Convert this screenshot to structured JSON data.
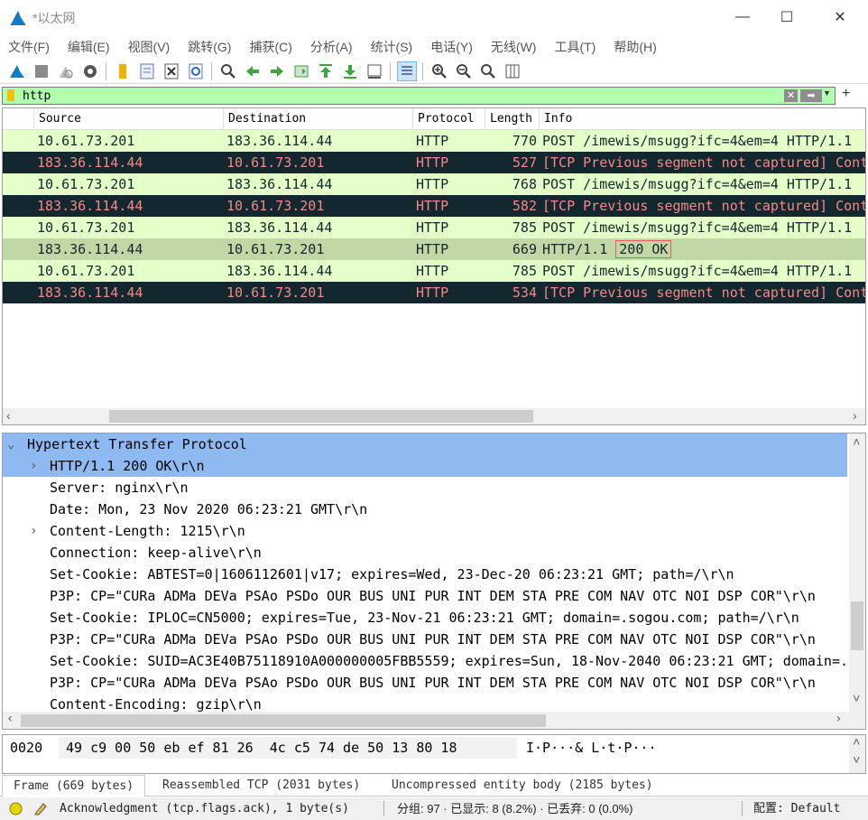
{
  "window": {
    "title": "*以太网",
    "controls": {
      "minimize": "—",
      "maximize": "☐",
      "close": "✕"
    }
  },
  "menu": [
    "文件(F)",
    "编辑(E)",
    "视图(V)",
    "跳转(G)",
    "捕获(C)",
    "分析(A)",
    "统计(S)",
    "电话(Y)",
    "无线(W)",
    "工具(T)",
    "帮助(H)"
  ],
  "toolbar": {
    "icons": [
      "shark-fin-start-icon",
      "stop-icon",
      "restart-icon",
      "options-gear-icon",
      "open-folder-icon",
      "save-file-icon",
      "close-file-icon",
      "reload-icon",
      "find-icon",
      "back-arrow-icon",
      "forward-arrow-icon",
      "go-to-packet-icon",
      "first-packet-icon",
      "last-packet-icon",
      "autoscroll-icon",
      "colorize-icon",
      "zoom-in-icon",
      "zoom-out-icon",
      "zoom-normal-icon",
      "resize-columns-icon"
    ]
  },
  "filter": {
    "value": "http",
    "clear_glyph": "✕",
    "apply_glyph": "➡",
    "dropdown_glyph": "▼",
    "add_glyph": "+"
  },
  "packet_list": {
    "columns": [
      "Source",
      "Destination",
      "Protocol",
      "Length",
      "Info"
    ],
    "rows": [
      {
        "src": "10.61.73.201",
        "dst": "183.36.114.44",
        "proto": "HTTP",
        "len": "770",
        "info": "POST /imewis/msugg?ifc=4&em=4 HTTP/1.1",
        "style": "normal"
      },
      {
        "src": "183.36.114.44",
        "dst": "10.61.73.201",
        "proto": "HTTP",
        "len": "527",
        "info": "[TCP Previous segment not captured] Continuation",
        "style": "error"
      },
      {
        "src": "10.61.73.201",
        "dst": "183.36.114.44",
        "proto": "HTTP",
        "len": "768",
        "info": "POST /imewis/msugg?ifc=4&em=4 HTTP/1.1",
        "style": "normal"
      },
      {
        "src": "183.36.114.44",
        "dst": "10.61.73.201",
        "proto": "HTTP",
        "len": "582",
        "info": "[TCP Previous segment not captured] Continuation",
        "style": "error"
      },
      {
        "src": "10.61.73.201",
        "dst": "183.36.114.44",
        "proto": "HTTP",
        "len": "785",
        "info": "POST /imewis/msugg?ifc=4&em=4 HTTP/1.1",
        "style": "normal"
      },
      {
        "src": "183.36.114.44",
        "dst": "10.61.73.201",
        "proto": "HTTP",
        "len": "669",
        "info_prefix": "HTTP/1.1 ",
        "info_boxed": "200 OK",
        "style": "selected"
      },
      {
        "src": "10.61.73.201",
        "dst": "183.36.114.44",
        "proto": "HTTP",
        "len": "785",
        "info": "POST /imewis/msugg?ifc=4&em=4 HTTP/1.1",
        "style": "normal"
      },
      {
        "src": "183.36.114.44",
        "dst": "10.61.73.201",
        "proto": "HTTP",
        "len": "534",
        "info": "[TCP Previous segment not captured] Continuation",
        "style": "error"
      }
    ]
  },
  "details": [
    {
      "text": "Hypertext Transfer Protocol",
      "indent": 0,
      "toggle": "⌄",
      "highlight": true
    },
    {
      "text": "HTTP/1.1 200 OK\\r\\n",
      "indent": 1,
      "toggle": "›",
      "highlight": true
    },
    {
      "text": "Server: nginx\\r\\n",
      "indent": 1
    },
    {
      "text": "Date: Mon, 23 Nov 2020 06:23:21 GMT\\r\\n",
      "indent": 1
    },
    {
      "text": "Content-Length: 1215\\r\\n",
      "indent": 1,
      "toggle": "›"
    },
    {
      "text": "Connection: keep-alive\\r\\n",
      "indent": 1
    },
    {
      "text": "Set-Cookie: ABTEST=0|1606112601|v17; expires=Wed, 23-Dec-20 06:23:21 GMT; path=/\\r\\n",
      "indent": 1
    },
    {
      "text": "P3P: CP=\"CURa ADMa DEVa PSAo PSDo OUR BUS UNI PUR INT DEM STA PRE COM NAV OTC NOI DSP COR\"\\r\\n",
      "indent": 1
    },
    {
      "text": "Set-Cookie: IPLOC=CN5000; expires=Tue, 23-Nov-21 06:23:21 GMT; domain=.sogou.com; path=/\\r\\n",
      "indent": 1
    },
    {
      "text": "P3P: CP=\"CURa ADMa DEVa PSAo PSDo OUR BUS UNI PUR INT DEM STA PRE COM NAV OTC NOI DSP COR\"\\r\\n",
      "indent": 1
    },
    {
      "text": "Set-Cookie: SUID=AC3E40B75118910A000000005FBB5559; expires=Sun, 18-Nov-2040 06:23:21 GMT; domain=.sogou.com\\r\\n",
      "indent": 1
    },
    {
      "text": "P3P: CP=\"CURa ADMa DEVa PSAo PSDo OUR BUS UNI PUR INT DEM STA PRE COM NAV OTC NOI DSP COR\"\\r\\n",
      "indent": 1
    },
    {
      "text": "Content-Encoding: gzip\\r\\n",
      "indent": 1
    }
  ],
  "bytes": {
    "offset": "0020",
    "hex": "49 c9 00 50 eb ef 81 26  4c c5 74 de 50 13 80 18",
    "ascii": "I·P···& L·t·P···"
  },
  "byte_tabs": [
    "Frame (669 bytes)",
    "Reassembled TCP (2031 bytes)",
    "Uncompressed entity body (2185 bytes)"
  ],
  "status": {
    "expert": "Acknowledgment (tcp.flags.ack), 1 byte(s)",
    "packets": "分组: 97 · 已显示: 8 (8.2%) · 已丢弃: 0 (0.0%)",
    "profile": "配置: Default"
  },
  "colors": {
    "row_normal_bg": "#e4ffc7",
    "row_normal_fg": "#12272e",
    "row_error_bg": "#12272e",
    "row_error_fg": "#f78787",
    "row_selected_bg": "#c2d7a6",
    "detail_highlight": "#8fb9f1",
    "filter_ok_bg": "#afffaf",
    "status_led": "#e6d600"
  }
}
